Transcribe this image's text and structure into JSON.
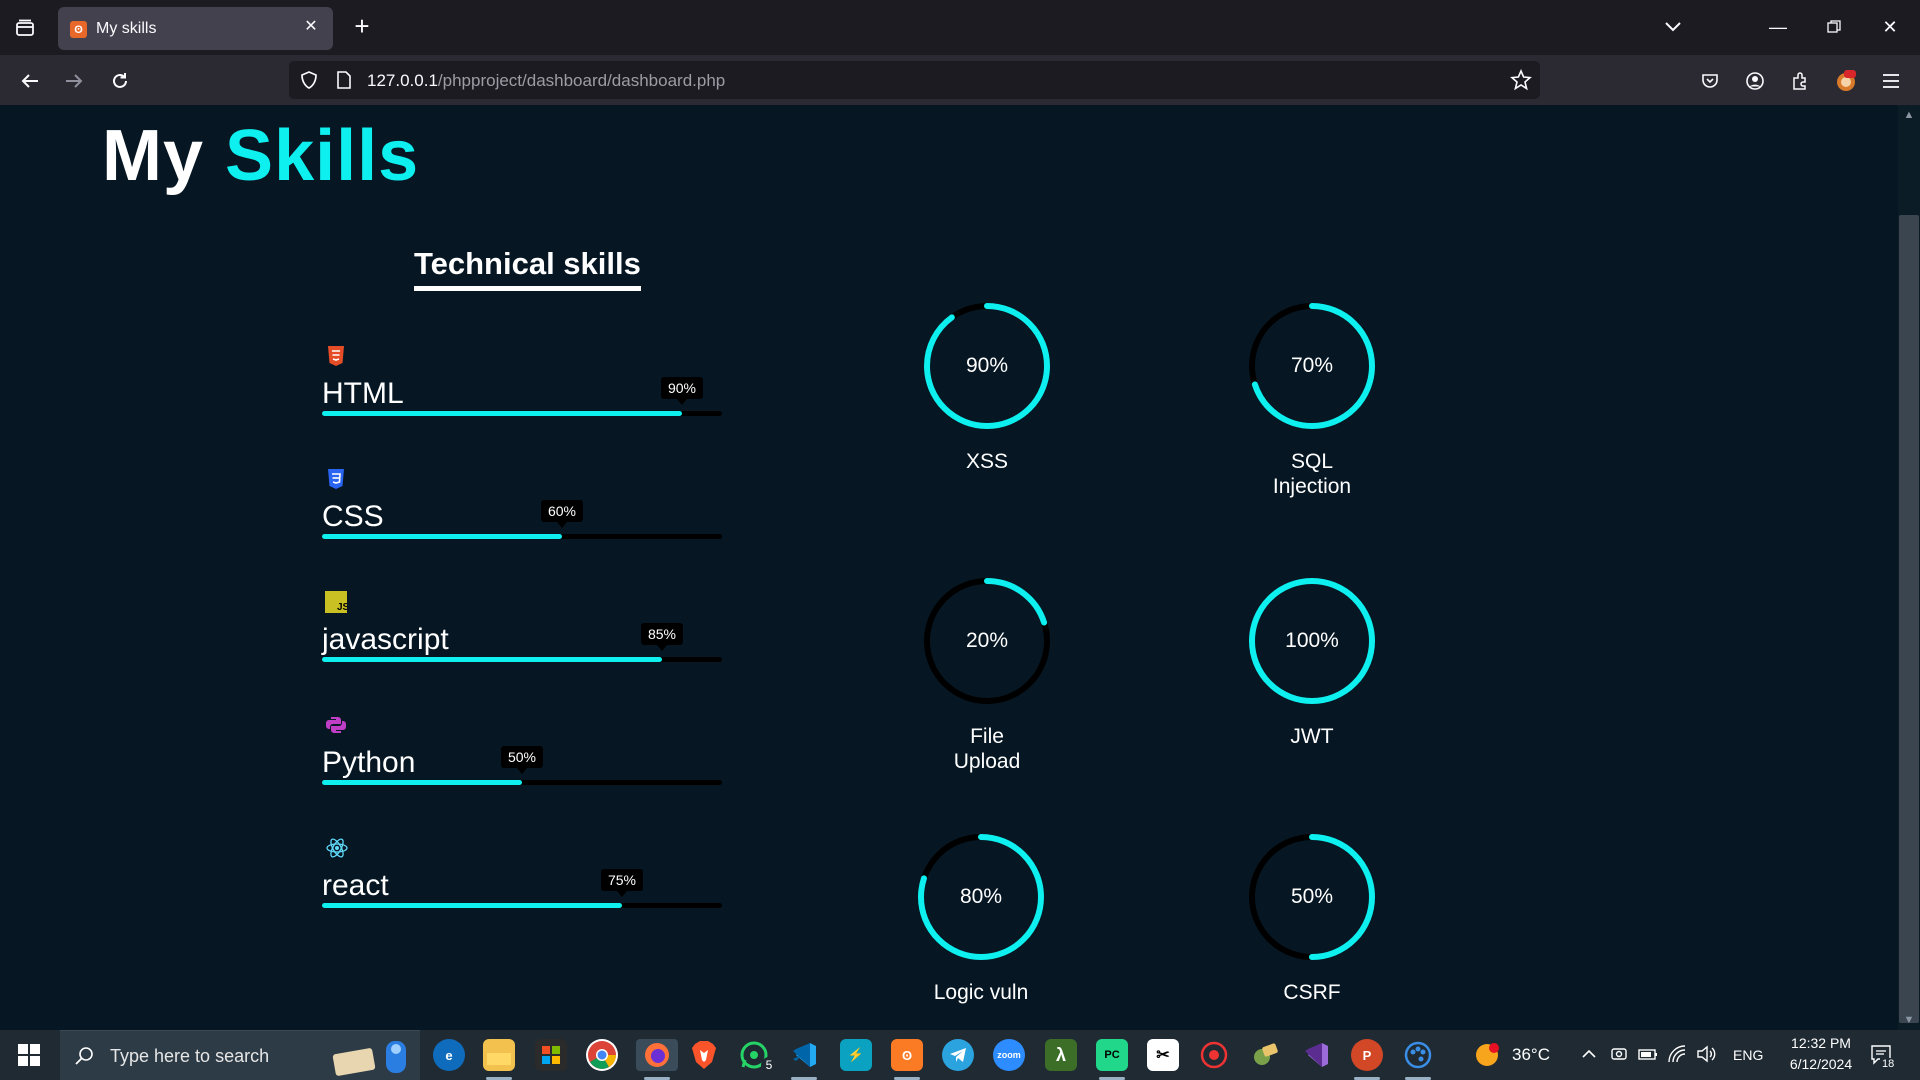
{
  "browser": {
    "tab_title": "My skills",
    "url_host": "127.0.0.1",
    "url_path": "/phpproject/dashboard/dashboard.php"
  },
  "page": {
    "heading_part1": "My",
    "heading_part2": "Skills",
    "section_title": "Technical skills",
    "colors": {
      "accent": "#0ef0f0",
      "background": "#061723",
      "track": "#000000"
    },
    "skills": [
      {
        "name": "HTML",
        "percent": 90,
        "percent_label": "90%",
        "icon": "html5-icon",
        "color": "#e44d26"
      },
      {
        "name": "CSS",
        "percent": 60,
        "percent_label": "60%",
        "icon": "css3-icon",
        "color": "#2965f1"
      },
      {
        "name": "javascript",
        "percent": 85,
        "percent_label": "85%",
        "icon": "javascript-icon",
        "color": "#c9c124"
      },
      {
        "name": "Python",
        "percent": 50,
        "percent_label": "50%",
        "icon": "python-icon",
        "color": "#c03ec6"
      },
      {
        "name": "react",
        "percent": 75,
        "percent_label": "75%",
        "icon": "react-icon",
        "color": "#61dafb"
      }
    ],
    "vulns": [
      {
        "label": "XSS",
        "percent": 90,
        "percent_label": "90%"
      },
      {
        "label": "SQL Injection",
        "percent": 70,
        "percent_label": "70%"
      },
      {
        "label": "File Upload",
        "percent": 20,
        "percent_label": "20%"
      },
      {
        "label": "JWT",
        "percent": 100,
        "percent_label": "100%"
      },
      {
        "label": "Logic vuln",
        "percent": 80,
        "percent_label": "80%"
      },
      {
        "label": "CSRF",
        "percent": 50,
        "percent_label": "50%"
      }
    ]
  },
  "taskbar": {
    "search_placeholder": "Type here to search",
    "whatsapp_badge": "5",
    "temperature": "36°C",
    "language": "ENG",
    "time": "12:32 PM",
    "date": "6/12/2024",
    "notification_count": "18"
  }
}
